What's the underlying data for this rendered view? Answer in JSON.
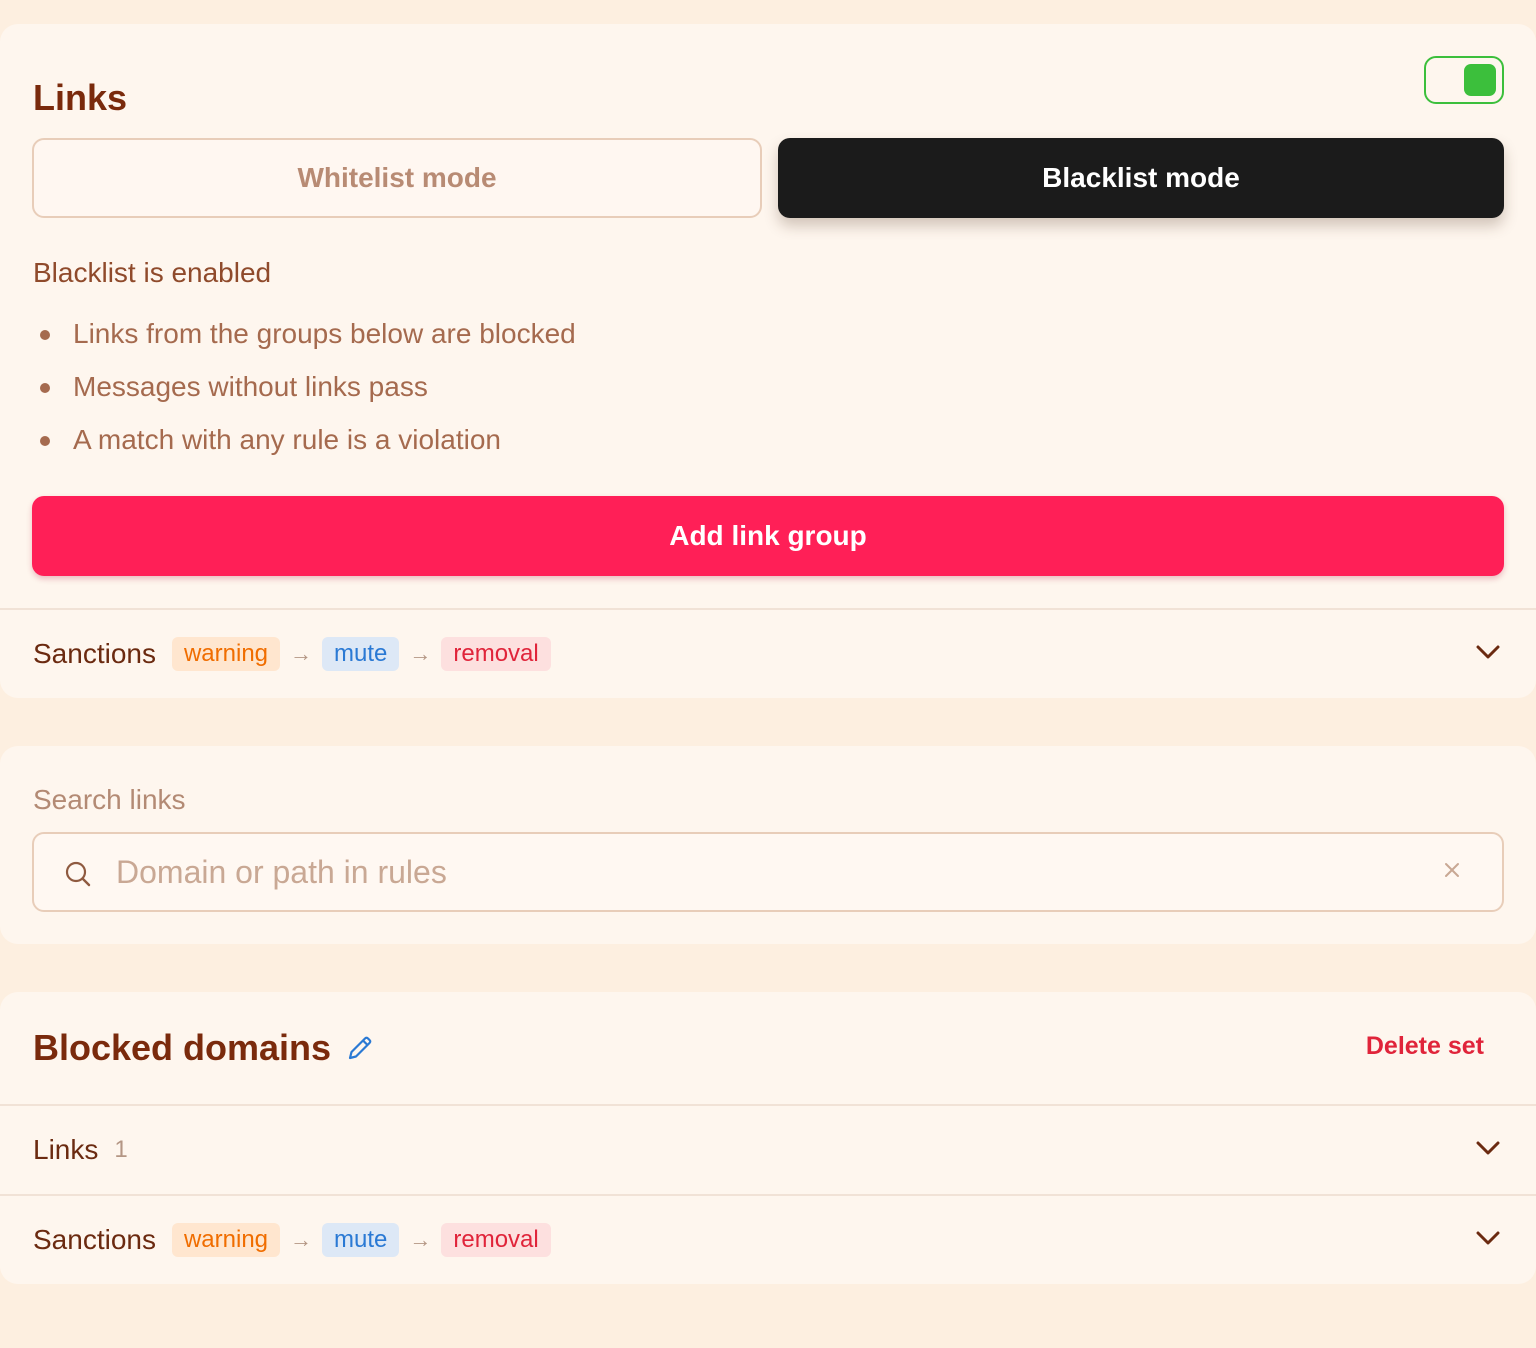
{
  "links_card": {
    "title": "Links",
    "toggle_enabled": true,
    "modes": {
      "whitelist": "Whitelist mode",
      "blacklist": "Blacklist mode",
      "selected": "blacklist"
    },
    "status_title": "Blacklist is enabled",
    "bullets": [
      "Links from the groups below are blocked",
      "Messages without links pass",
      "A match with any rule is a violation"
    ],
    "add_button": "Add link group",
    "sanctions": {
      "label": "Sanctions",
      "steps": [
        "warning",
        "mute",
        "removal"
      ]
    }
  },
  "search": {
    "label": "Search links",
    "placeholder": "Domain or path in rules",
    "value": ""
  },
  "set_card": {
    "title": "Blocked domains",
    "delete_label": "Delete set",
    "links_label": "Links",
    "links_count": "1",
    "sanctions": {
      "label": "Sanctions",
      "steps": [
        "warning",
        "mute",
        "removal"
      ]
    }
  },
  "icons": {
    "toggle": "toggle-switch-icon",
    "chevron": "chevron-down-icon",
    "search": "search-icon",
    "clear": "close-icon",
    "edit": "pencil-icon",
    "arrow": "arrow-right-icon"
  },
  "colors": {
    "accent_red": "#ff1f57",
    "toggle_green": "#3cbf3c",
    "dark_button": "#1b1b1b",
    "warning": "#f06d00",
    "mute": "#2a79d4",
    "removal": "#e0243a"
  }
}
